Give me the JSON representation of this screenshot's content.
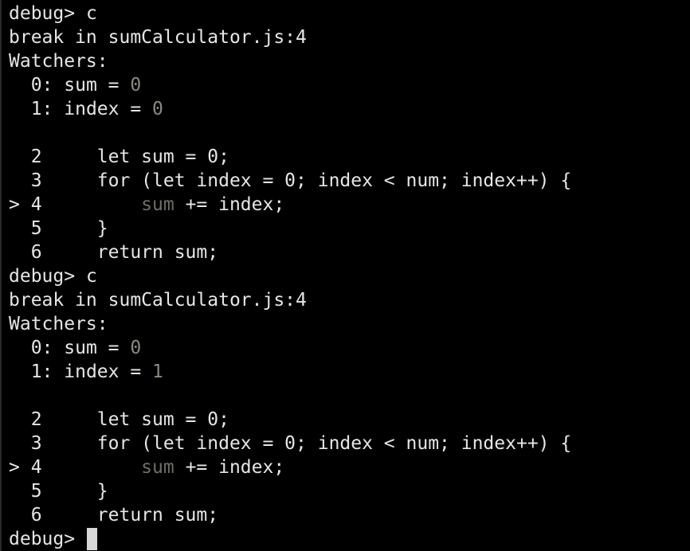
{
  "colors": {
    "background": "#000000",
    "foreground": "#e6e6e6",
    "dim": "#8a8a80",
    "cursor": "#d8d8d8"
  },
  "blocks": [
    {
      "prompt": "debug> ",
      "command": "c",
      "break_line": "break in sumCalculator.js:4",
      "watchers_header": "Watchers:",
      "watchers": [
        {
          "index": "  0: ",
          "name": "sum",
          "eq": " = ",
          "value": "0"
        },
        {
          "index": "  1: ",
          "name": "index",
          "eq": " = ",
          "value": "0"
        }
      ],
      "source": [
        {
          "prefix": "  2     ",
          "code": "let sum = 0;"
        },
        {
          "prefix": "  3     ",
          "code": "for (let index = 0; index < num; index++) {"
        },
        {
          "prefix": "> 4         ",
          "dim_word": "sum",
          "code": " += index;"
        },
        {
          "prefix": "  5     ",
          "code": "}"
        },
        {
          "prefix": "  6     ",
          "code": "return sum;"
        }
      ]
    },
    {
      "prompt": "debug> ",
      "command": "c",
      "break_line": "break in sumCalculator.js:4",
      "watchers_header": "Watchers:",
      "watchers": [
        {
          "index": "  0: ",
          "name": "sum",
          "eq": " = ",
          "value": "0"
        },
        {
          "index": "  1: ",
          "name": "index",
          "eq": " = ",
          "value": "1"
        }
      ],
      "source": [
        {
          "prefix": "  2     ",
          "code": "let sum = 0;"
        },
        {
          "prefix": "  3     ",
          "code": "for (let index = 0; index < num; index++) {"
        },
        {
          "prefix": "> 4         ",
          "dim_word": "sum",
          "code": " += index;"
        },
        {
          "prefix": "  5     ",
          "code": "}"
        },
        {
          "prefix": "  6     ",
          "code": "return sum;"
        }
      ]
    }
  ],
  "final_prompt": "debug> "
}
